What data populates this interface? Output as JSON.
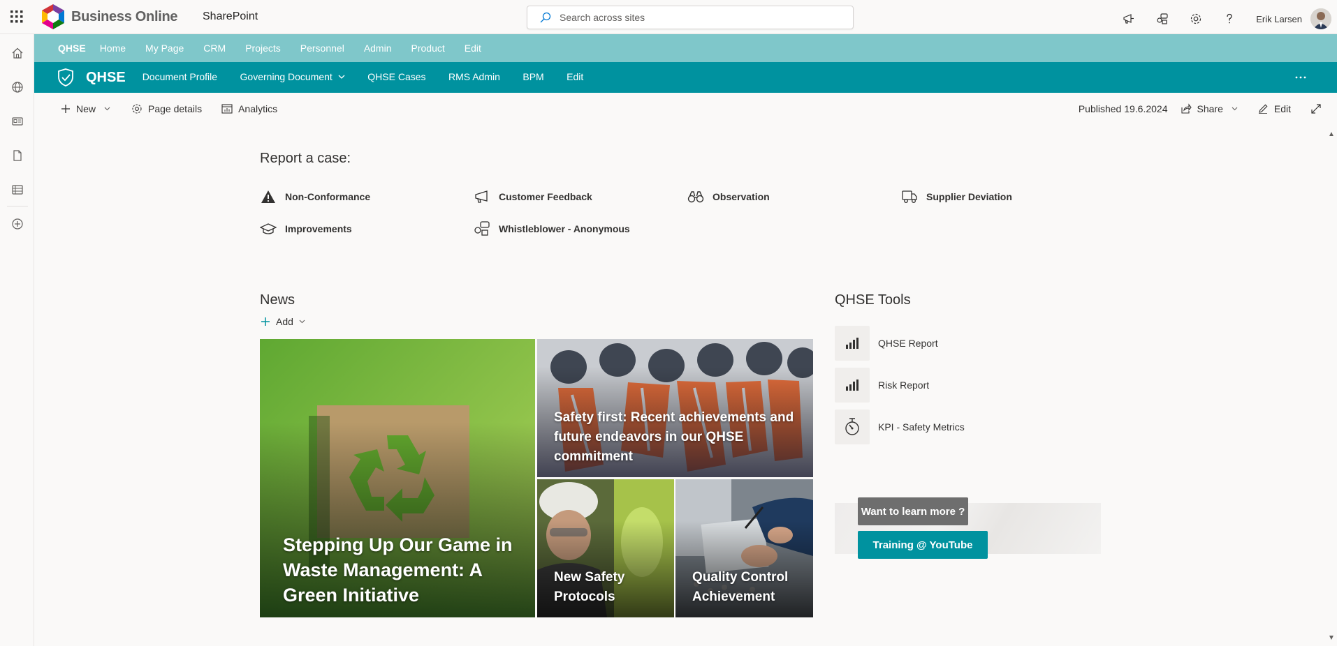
{
  "suitebar": {
    "app_name": "Business Online",
    "product": "SharePoint",
    "search_placeholder": "Search across sites",
    "user_name": "Erik Larsen"
  },
  "hubnav": {
    "title": "QHSE",
    "items": [
      "Home",
      "My Page",
      "CRM",
      "Projects",
      "Personnel",
      "Admin",
      "Product",
      "Edit"
    ]
  },
  "siteheader": {
    "title": "QHSE",
    "nav": [
      "Document Profile",
      "Governing Document",
      "QHSE Cases",
      "RMS Admin",
      "BPM",
      "Edit"
    ]
  },
  "cmdbar": {
    "new_label": "New",
    "page_details_label": "Page details",
    "analytics_label": "Analytics",
    "published": "Published 19.6.2024",
    "share_label": "Share",
    "edit_label": "Edit"
  },
  "report": {
    "heading": "Report a case:",
    "items": [
      {
        "label": "Non-Conformance",
        "icon": "warning-icon"
      },
      {
        "label": "Customer Feedback",
        "icon": "megaphone-icon"
      },
      {
        "label": "Observation",
        "icon": "binoculars-icon"
      },
      {
        "label": "Supplier Deviation",
        "icon": "truck-icon"
      },
      {
        "label": "Improvements",
        "icon": "graduation-cap-icon"
      },
      {
        "label": "Whistleblower - Anonymous",
        "icon": "chat-shapes-icon"
      }
    ]
  },
  "news": {
    "heading": "News",
    "add_label": "Add",
    "tiles": [
      {
        "title": "Stepping Up Our Game in Waste Management: A Green Initiative"
      },
      {
        "title": "Safety first: Recent achievements and future endeavors in our QHSE commitment"
      },
      {
        "title": "New Safety Protocols"
      },
      {
        "title": "Quality Control Achievement"
      }
    ]
  },
  "tools": {
    "heading": "QHSE Tools",
    "items": [
      {
        "label": "QHSE Report",
        "icon": "bar-chart-icon"
      },
      {
        "label": "Risk Report",
        "icon": "bar-chart-icon"
      },
      {
        "label": "KPI - Safety Metrics",
        "icon": "gauge-icon"
      }
    ]
  },
  "learn": {
    "want_more": "Want to learn more ?",
    "youtube": "Training @ YouTube"
  },
  "colors": {
    "hub": "#7fc7ca",
    "site": "#00929f",
    "background": "#faf9f8"
  }
}
